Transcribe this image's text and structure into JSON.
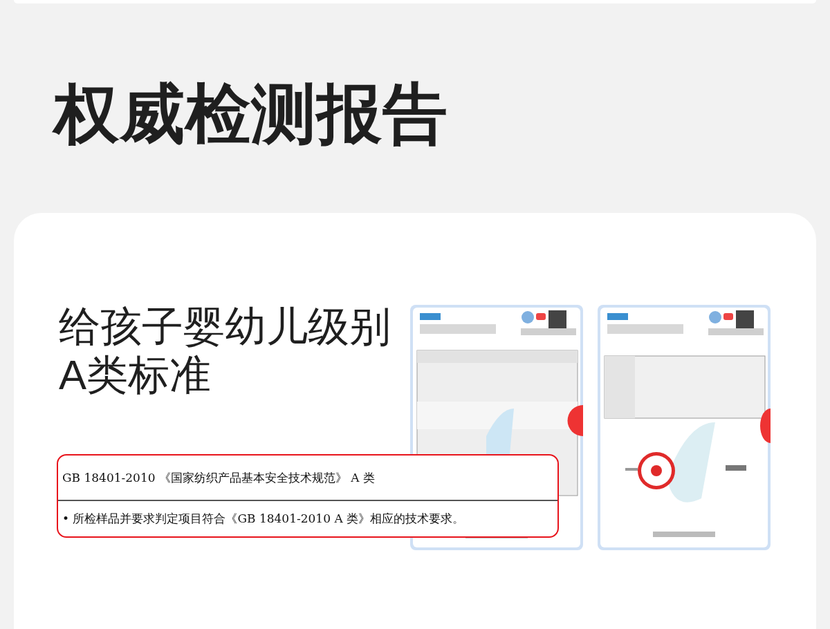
{
  "header": {
    "title": "权威检测报告"
  },
  "section": {
    "heading_lines": [
      "给孩子婴幼儿级别",
      "A类标准"
    ],
    "callout": {
      "standard": "GB 18401-2010 《国家纺织产品基本安全技术规范》 A 类",
      "conclusion": "• 所检样品并要求判定项目符合《GB 18401-2010 A 类》相应的技术要求。"
    }
  }
}
